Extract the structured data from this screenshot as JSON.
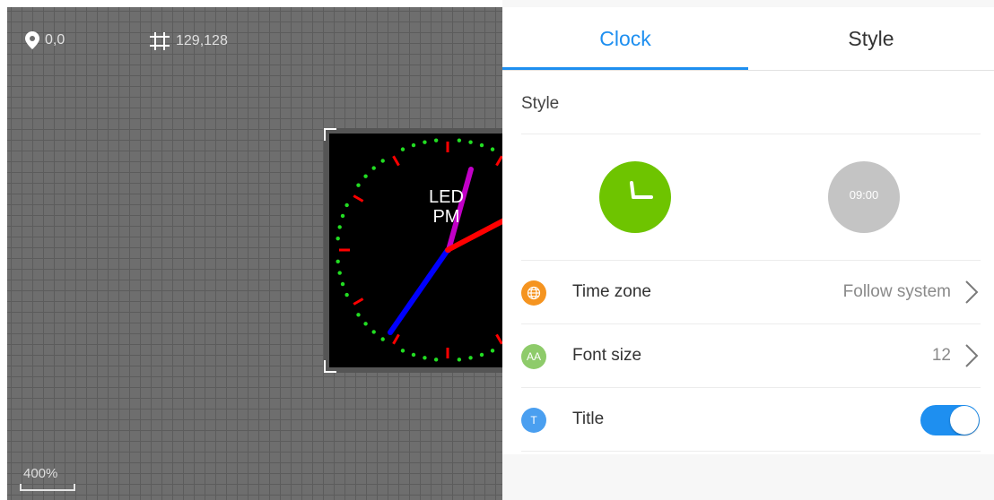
{
  "canvas": {
    "position_readout": "0,0",
    "size_readout": "129,128",
    "zoom_label": "400%",
    "clock_preview_text": [
      "LED",
      "PM"
    ]
  },
  "tabs": [
    {
      "label": "Clock",
      "active": true
    },
    {
      "label": "Style",
      "active": false
    }
  ],
  "style_section": {
    "title": "Style",
    "options": [
      {
        "name": "analog",
        "selected": true
      },
      {
        "name": "digital",
        "text": "09:00",
        "selected": false
      }
    ]
  },
  "settings": {
    "time_zone": {
      "label": "Time zone",
      "value": "Follow system",
      "icon": "globe-icon"
    },
    "font_size": {
      "label": "Font size",
      "value": "12",
      "icon": "font-size-icon",
      "icon_text": "AA"
    },
    "title": {
      "label": "Title",
      "enabled": true,
      "icon": "title-icon",
      "icon_text": "T"
    }
  },
  "colors": {
    "accent": "#1e8ff0",
    "analog_style": "#6ec400",
    "digital_style": "#c4c4c4",
    "time_zone_icon": "#f59420",
    "font_size_icon": "#8ecb6a",
    "title_icon": "#4a9ff0"
  }
}
